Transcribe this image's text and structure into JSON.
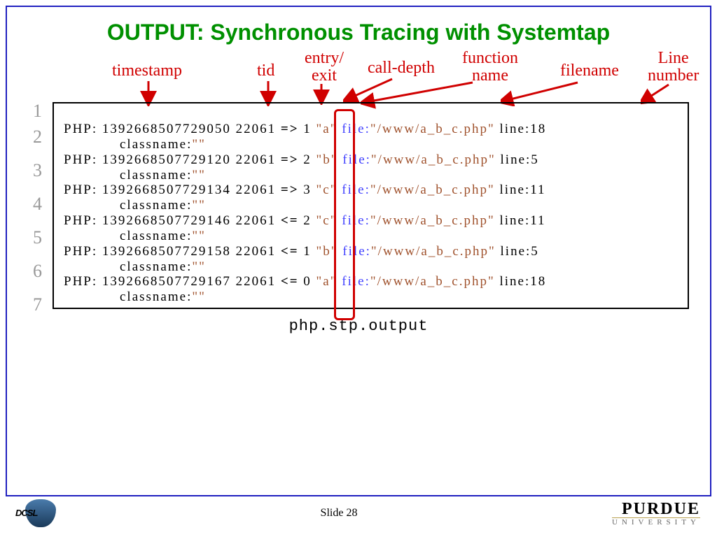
{
  "title": "OUTPUT: Synchronous Tracing with Systemtap",
  "labels": {
    "timestamp": "timestamp",
    "tid": "tid",
    "entry_exit": "entry/\nexit",
    "call_depth": "call-depth",
    "func_name": "function\nname",
    "filename": "filename",
    "line_number": "Line\nnumber"
  },
  "trace": {
    "line_nums": [
      "1",
      "2",
      "3",
      "4",
      "5",
      "6",
      "7"
    ],
    "rows": [
      {
        "prefix": "PHP:",
        "ts": "1392668507729050",
        "tid": "22061",
        "arrow": "=>",
        "depth": "1",
        "func": "\"a\"",
        "file_key": "file:",
        "file": "\"/www/a_b_c.php\"",
        "line_key": "line:",
        "line": "18",
        "cls_key": "classname:",
        "cls": "\"\""
      },
      {
        "prefix": "PHP:",
        "ts": "1392668507729120",
        "tid": "22061",
        "arrow": "=>",
        "depth": "2",
        "func": "\"b\"",
        "file_key": "file:",
        "file": "\"/www/a_b_c.php\"",
        "line_key": "line:",
        "line": "5",
        "cls_key": "classname:",
        "cls": "\"\""
      },
      {
        "prefix": "PHP:",
        "ts": "1392668507729134",
        "tid": "22061",
        "arrow": "=>",
        "depth": "3",
        "func": "\"c\"",
        "file_key": "file:",
        "file": "\"/www/a_b_c.php\"",
        "line_key": "line:",
        "line": "11",
        "cls_key": "classname:",
        "cls": "\"\""
      },
      {
        "prefix": "PHP:",
        "ts": "1392668507729146",
        "tid": "22061",
        "arrow": "<=",
        "depth": "2",
        "func": "\"c\"",
        "file_key": "file:",
        "file": "\"/www/a_b_c.php\"",
        "line_key": "line:",
        "line": "11",
        "cls_key": "classname:",
        "cls": "\"\""
      },
      {
        "prefix": "PHP:",
        "ts": "1392668507729158",
        "tid": "22061",
        "arrow": "<=",
        "depth": "1",
        "func": "\"b\"",
        "file_key": "file:",
        "file": "\"/www/a_b_c.php\"",
        "line_key": "line:",
        "line": "5",
        "cls_key": "classname:",
        "cls": "\"\""
      },
      {
        "prefix": "PHP:",
        "ts": "1392668507729167",
        "tid": "22061",
        "arrow": "<=",
        "depth": "0",
        "func": "\"a\"",
        "file_key": "file:",
        "file": "\"/www/a_b_c.php\"",
        "line_key": "line:",
        "line": "18",
        "cls_key": "classname:",
        "cls": "\"\""
      }
    ]
  },
  "caption": "php.stp.output",
  "footer": {
    "slide": "Slide 28",
    "left_logo": "DCSL",
    "right_logo_top": "PURDUE",
    "right_logo_bottom": "UNIVERSITY"
  }
}
